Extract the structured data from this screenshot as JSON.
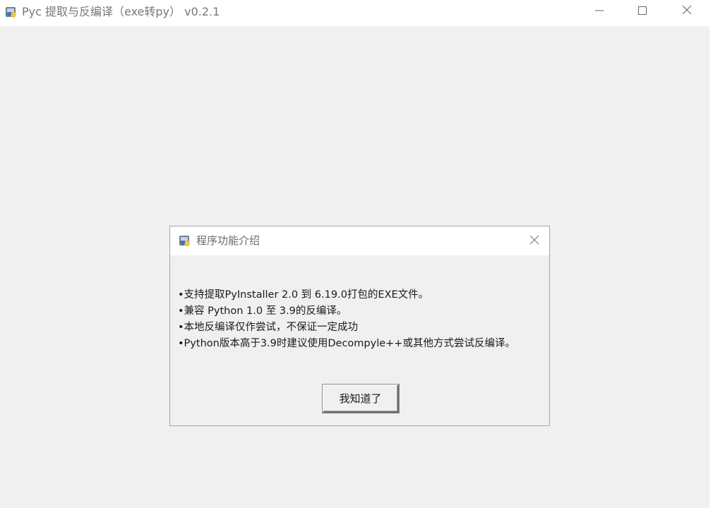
{
  "window": {
    "title": "Pyc 提取与反编译（exe转py） v0.2.1",
    "app_icon": "python-package-icon",
    "controls": {
      "minimize_icon": "minimize-icon",
      "maximize_icon": "maximize-icon",
      "close_icon": "close-icon"
    }
  },
  "dialog": {
    "title": "程序功能介绍",
    "icon": "python-package-icon",
    "close_icon": "close-icon",
    "lines": [
      "•支持提取PyInstaller 2.0 到 6.19.0打包的EXE文件。",
      "•兼容 Python 1.0 至 3.9的反编译。",
      "•本地反编译仅作尝试，不保证一定成功",
      "•Python版本高于3.9时建议使用Decompyle++或其他方式尝试反编译。"
    ],
    "ok_label": "我知道了"
  }
}
